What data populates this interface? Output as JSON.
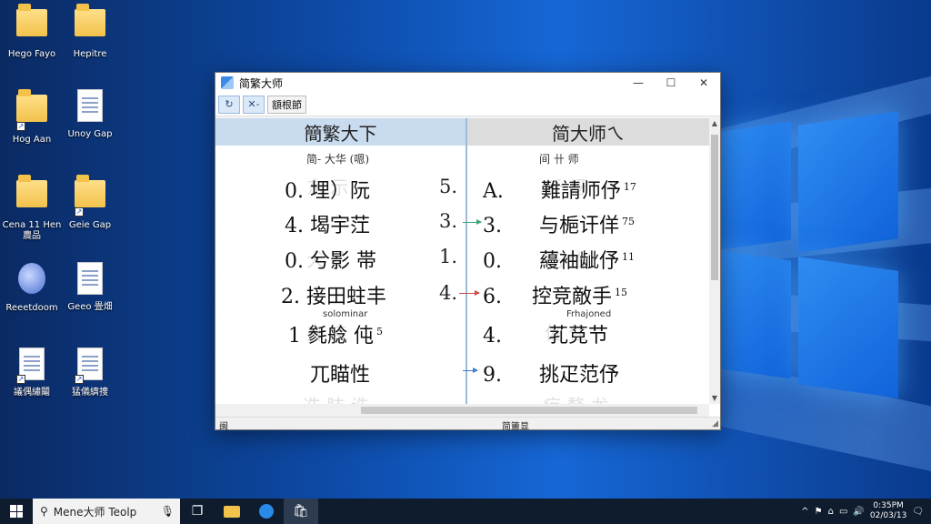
{
  "desktop": {
    "icons": [
      {
        "label": "Hego Fayo",
        "type": "folder"
      },
      {
        "label": "Hepitre",
        "type": "folder"
      },
      {
        "label": "Hog Aan",
        "type": "folder"
      },
      {
        "label": "Unoy Gap",
        "type": "doc"
      },
      {
        "label": "Cena 11 Hen 農品",
        "type": "folder"
      },
      {
        "label": "Geie Gap",
        "type": "folder"
      },
      {
        "label": "Reeetdoom",
        "type": "app"
      },
      {
        "label": "Geeo 畳畑",
        "type": "doc"
      },
      {
        "label": "議偶繡鬮",
        "type": "doc"
      },
      {
        "label": "猛儀纃捜",
        "type": "doc"
      }
    ]
  },
  "window": {
    "title": "简繁大师",
    "controls": {
      "minimize": "—",
      "maximize": "☐",
      "close": "✕"
    },
    "toolbar": {
      "refresh": "↻",
      "tool": "✕-",
      "text_button": "額根節"
    },
    "left_header": "簡繁大下",
    "right_header": "简大师ㄟ",
    "left_subheader": "简- 大华 (嗯)",
    "right_subheader": "间 卄  师",
    "left_rows": [
      {
        "text": "0. 埋）阮",
        "sup": ""
      },
      {
        "text": "4. 堨宇茳",
        "sup": ""
      },
      {
        "text": "0. 兮影 帯",
        "sup": ""
      },
      {
        "text": "2. 接田蛀丰",
        "sup": ""
      },
      {
        "text": "1 毵艌 伅",
        "sup": "5"
      },
      {
        "text": "兀瞄性",
        "sup": ""
      }
    ],
    "middle_numbers": [
      "5.",
      "3.",
      "1.",
      "4."
    ],
    "right_rows": [
      {
        "index": "A.",
        "text": "難請师伃",
        "sup": "17"
      },
      {
        "index": "3.",
        "text": "与梔讦佯",
        "sup": "75"
      },
      {
        "index": "0.",
        "text": "蘰袖龇伃",
        "sup": "11"
      },
      {
        "index": "6.",
        "text": "控竞敵手",
        "sup": "15"
      },
      {
        "index": "4.",
        "text": "芤莌节",
        "sup": ""
      },
      {
        "index": "9.",
        "text": "挑疋范伃",
        "sup": ""
      }
    ],
    "left_small_label": "solominar",
    "right_small_label": "Frhajoned",
    "status_left": "闽",
    "status_middle": "简簠显"
  },
  "taskbar": {
    "search_text": "Mene大师 Teolp",
    "clock_time": "0:35PM",
    "clock_date": "02/03/13"
  }
}
